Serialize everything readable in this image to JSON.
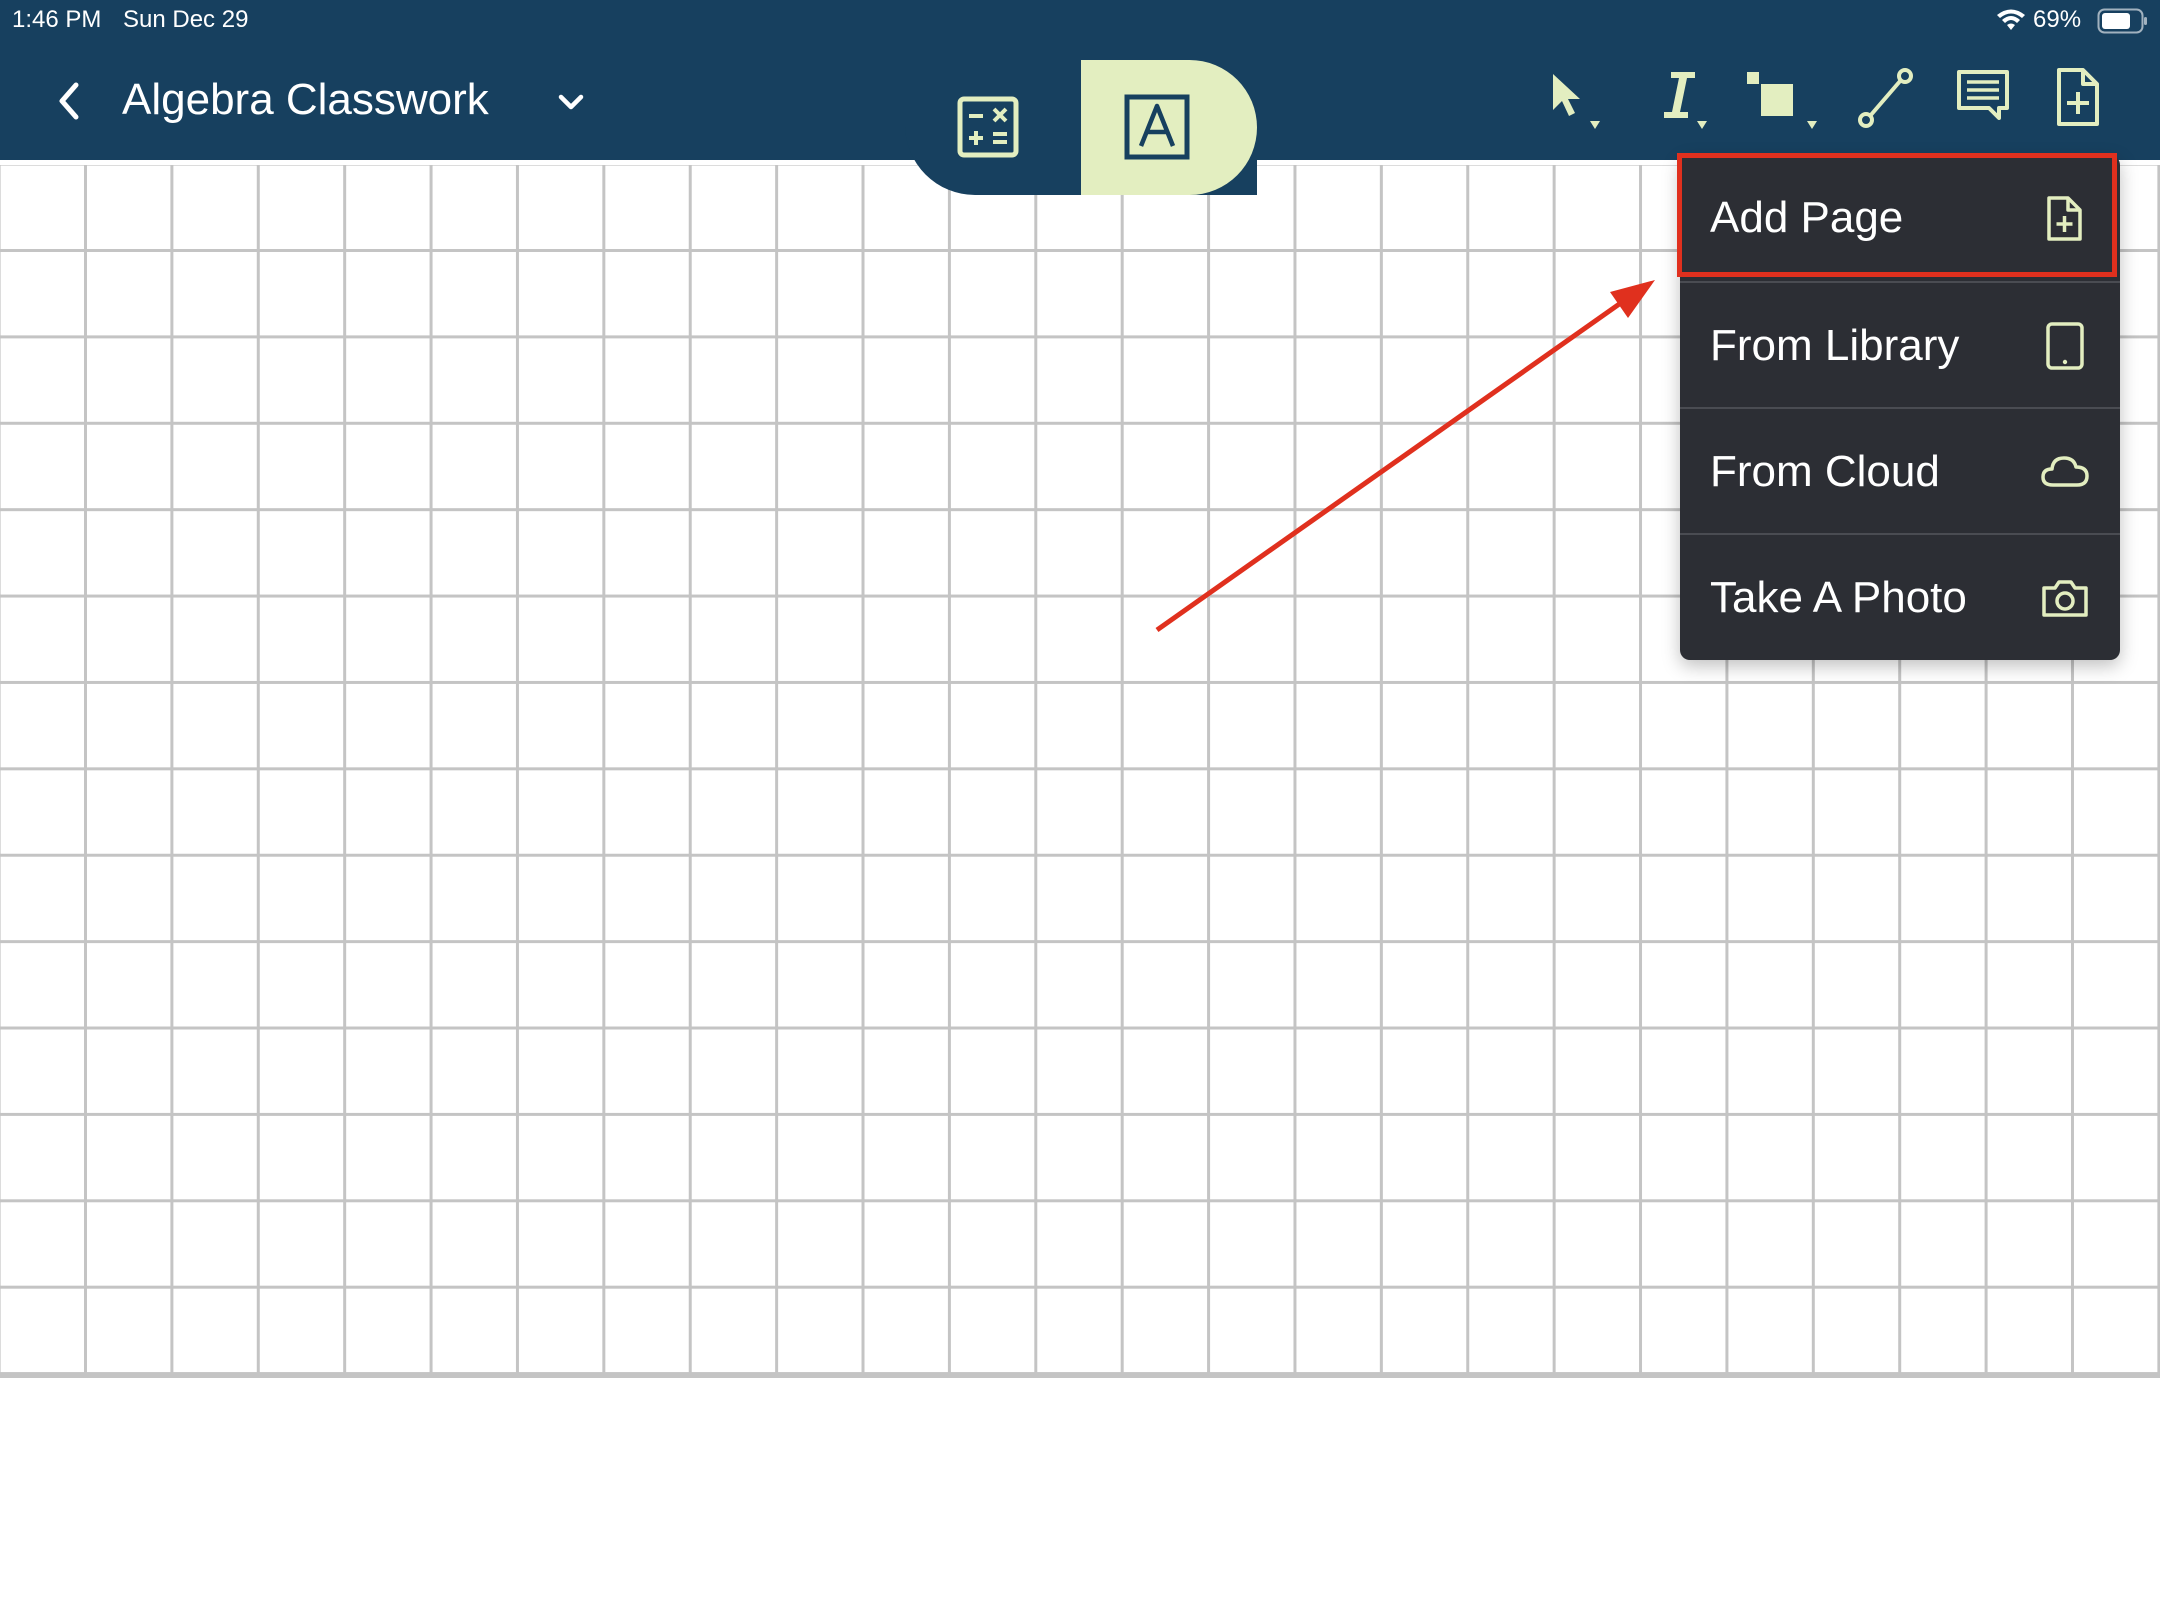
{
  "status_bar": {
    "time": "1:46 PM",
    "date": "Sun Dec 29",
    "battery_percent": "69%"
  },
  "header": {
    "title": "Algebra Classwork",
    "back_icon": "chevron-left-icon",
    "dropdown_icon": "chevron-down-icon"
  },
  "mode_switch": {
    "modes": [
      {
        "name": "calculator",
        "icon": "calculator-icon",
        "selected": false
      },
      {
        "name": "text",
        "icon": "text-box-icon",
        "selected": true
      }
    ]
  },
  "toolbar": {
    "tools": [
      {
        "icon": "pointer-icon"
      },
      {
        "icon": "text-cursor-icon"
      },
      {
        "icon": "shapes-icon"
      },
      {
        "icon": "line-tool-icon"
      },
      {
        "icon": "comment-icon"
      },
      {
        "icon": "add-page-icon"
      }
    ]
  },
  "menu": {
    "items": [
      {
        "label": "Add Page",
        "icon": "add-page-icon",
        "highlighted": true
      },
      {
        "label": "From Library",
        "icon": "tablet-icon"
      },
      {
        "label": "From Cloud",
        "icon": "cloud-icon"
      },
      {
        "label": "Take A Photo",
        "icon": "camera-icon"
      }
    ]
  },
  "colors": {
    "header": "#17405f",
    "accent": "#e3eec0",
    "menu_bg": "#2c2e34",
    "annotation": "#e0301e",
    "grid_line": "#c4c4c4"
  }
}
